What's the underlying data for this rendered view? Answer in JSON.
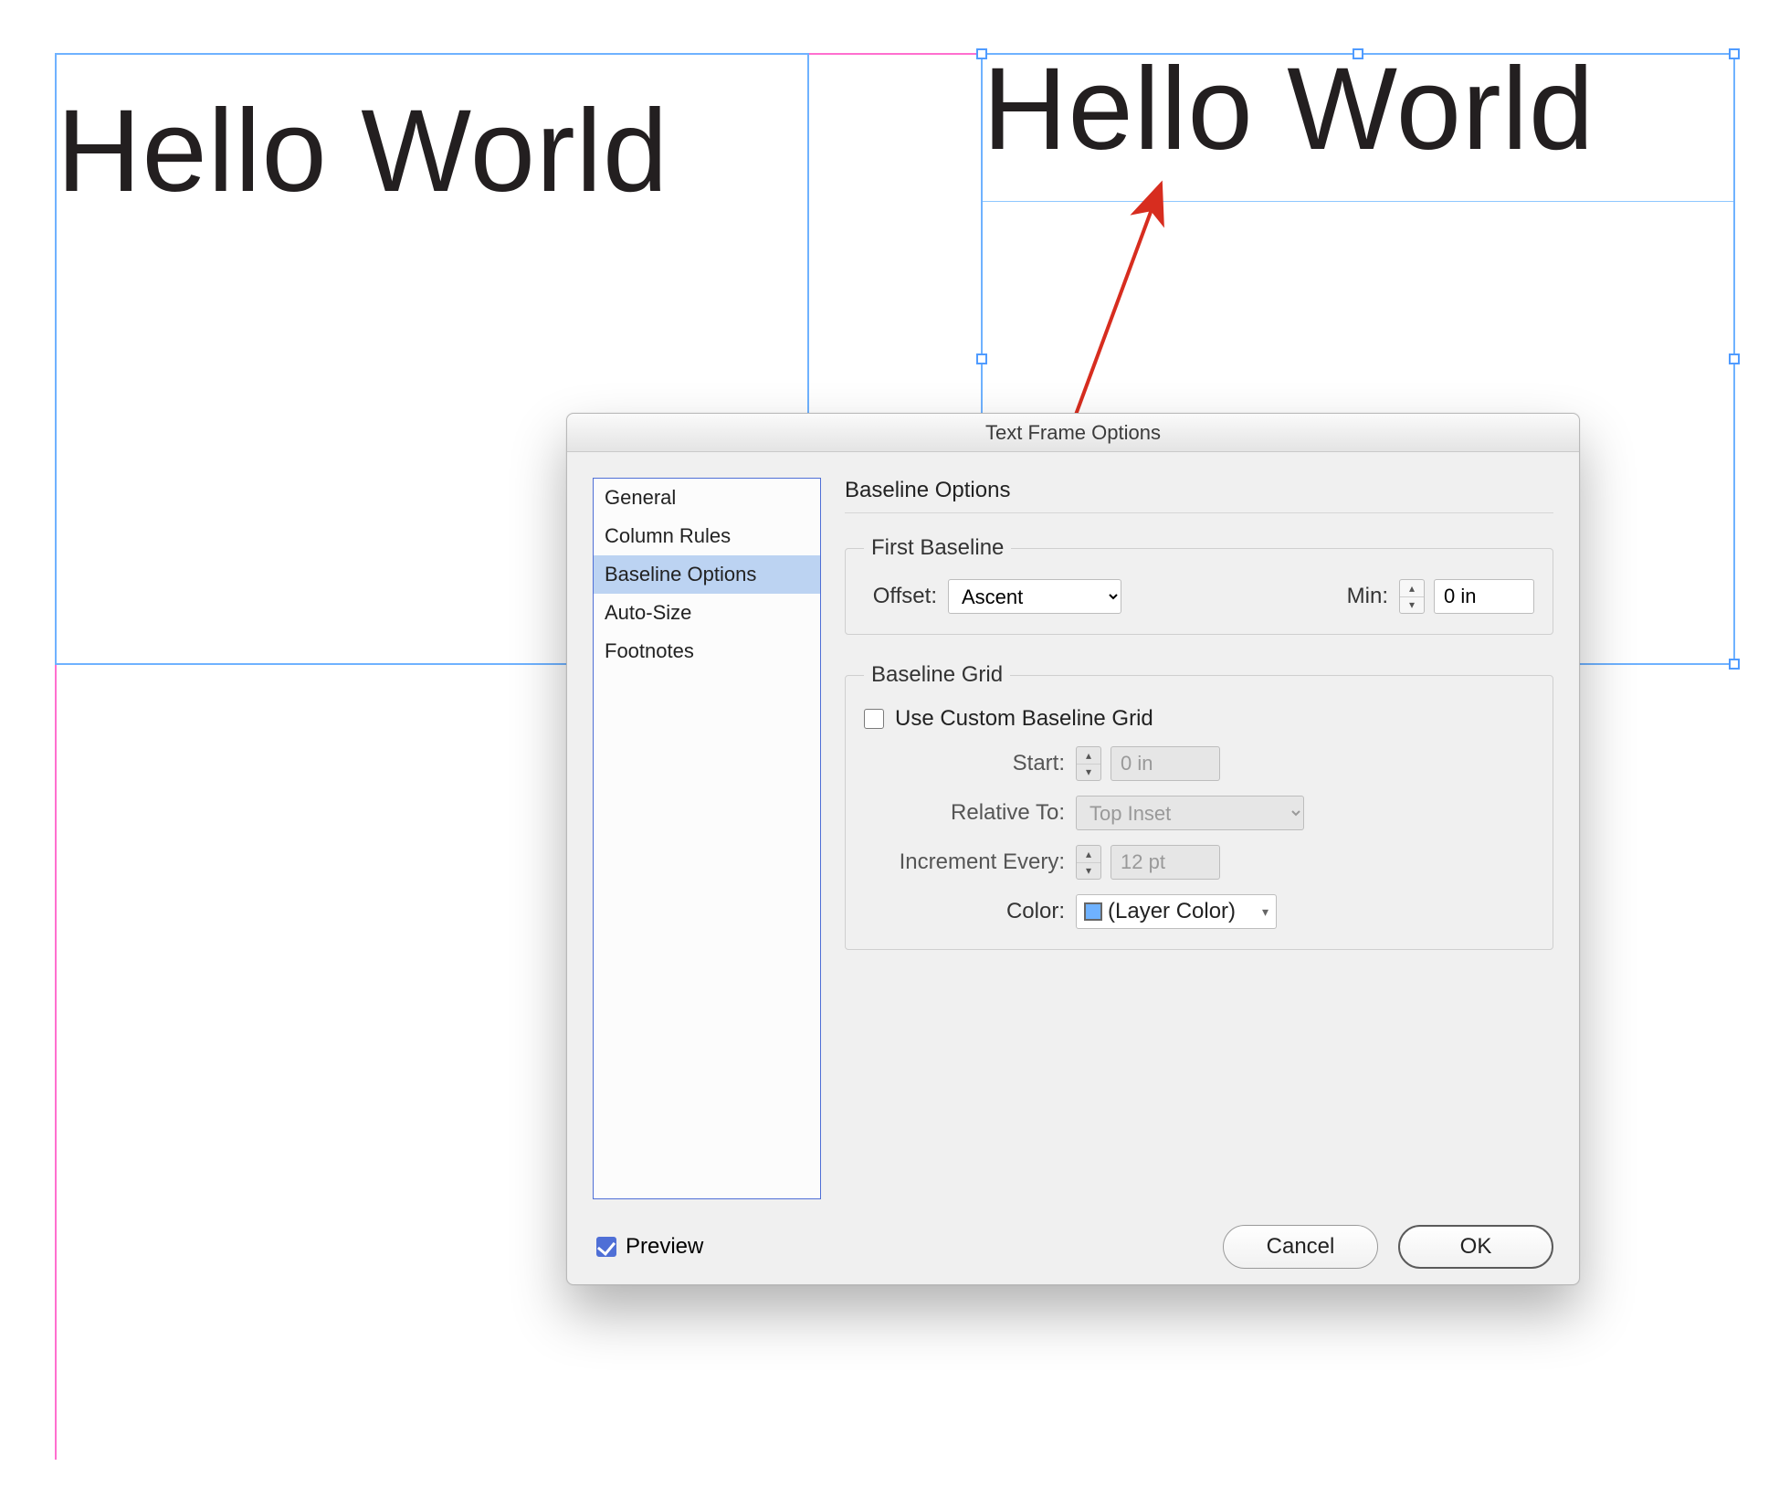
{
  "canvas": {
    "left_text": "Hello World",
    "right_text": "Hello World"
  },
  "dialog": {
    "title": "Text Frame Options",
    "sidebar": {
      "items": [
        {
          "label": "General"
        },
        {
          "label": "Column Rules"
        },
        {
          "label": "Baseline Options"
        },
        {
          "label": "Auto-Size"
        },
        {
          "label": "Footnotes"
        }
      ],
      "selected_index": 2
    },
    "panel_title": "Baseline Options",
    "first_baseline": {
      "legend": "First Baseline",
      "offset_label": "Offset:",
      "offset_value": "Ascent",
      "min_label": "Min:",
      "min_value": "0 in"
    },
    "baseline_grid": {
      "legend": "Baseline Grid",
      "use_custom_label": "Use Custom Baseline Grid",
      "use_custom_checked": false,
      "start_label": "Start:",
      "start_value": "0 in",
      "relative_to_label": "Relative To:",
      "relative_to_value": "Top Inset",
      "increment_label": "Increment Every:",
      "increment_value": "12 pt",
      "color_label": "Color:",
      "color_value": "(Layer Color)"
    },
    "footer": {
      "preview_label": "Preview",
      "preview_checked": true,
      "cancel": "Cancel",
      "ok": "OK"
    }
  }
}
